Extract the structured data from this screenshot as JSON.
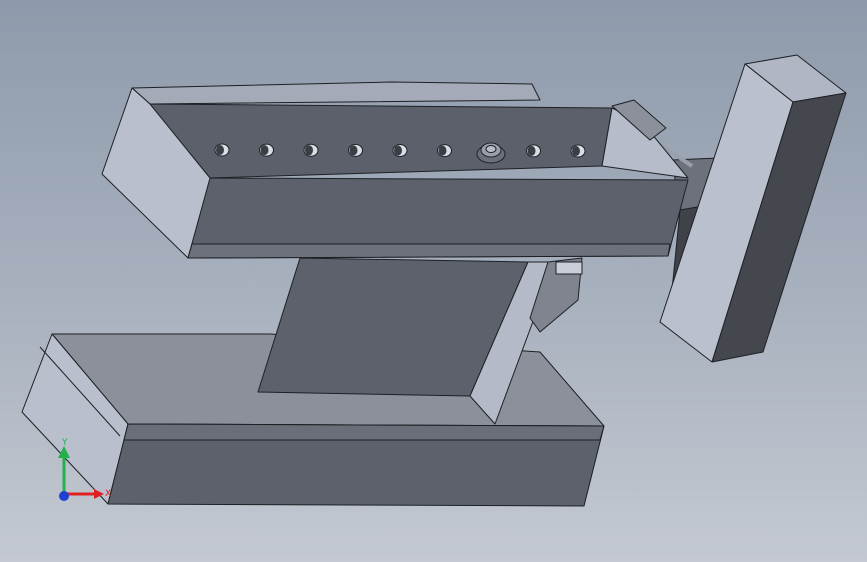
{
  "viewport": {
    "background_top": "#8e9aab",
    "background_bottom": "#c4c9d1"
  },
  "model": {
    "part_colors": {
      "light_face": "#b9bfcc",
      "mid_face": "#8a8f9a",
      "dark_face": "#5c606b",
      "darkest_face": "#3c3f46",
      "edge": "#1e2024"
    },
    "hole_count": 9
  },
  "triad": {
    "y_label": "Y",
    "x_label": "X",
    "colors": {
      "y_axis": "#22b14c",
      "x_axis": "#e02020",
      "z_axis": "#1f3fd0"
    }
  }
}
